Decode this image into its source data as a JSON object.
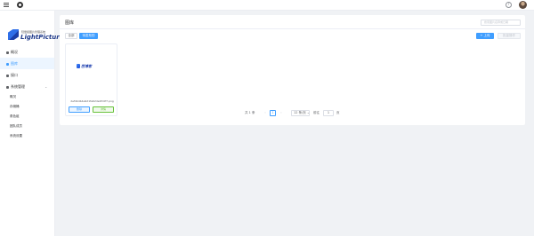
{
  "header": {
    "menu_icon": "hamburger-menu-icon",
    "github_icon": "github-icon",
    "help_icon": "question-circle-icon",
    "help_glyph": "?"
  },
  "sidebar": {
    "logo_tagline": "轻量级图片管理系统",
    "logo_text": "LightPicture",
    "items": [
      {
        "label": "概况",
        "icon": "dashboard-icon"
      },
      {
        "label": "图库",
        "icon": "gallery-icon",
        "active": true
      },
      {
        "label": "接口",
        "icon": "api-icon"
      },
      {
        "label": "系统管理",
        "icon": "settings-icon",
        "caret": "⌄"
      }
    ],
    "subitems": [
      {
        "label": "概况"
      },
      {
        "label": "存储桶"
      },
      {
        "label": "角色组"
      },
      {
        "label": "团队成员"
      },
      {
        "label": "系统设置"
      }
    ]
  },
  "main": {
    "title": "图库",
    "search_placeholder": "搜索图片名称或日期",
    "tabs": [
      {
        "label": "全部"
      },
      {
        "label": "待发布的"
      }
    ],
    "upload_button": "+ 上传",
    "batch_button": "批量操作",
    "images": [
      {
        "thumb_text": "芭博客",
        "filename": "2ef4b4b4e9d1fe62de0fc0f7.png",
        "delete_label": "删除",
        "publish_label": "详情"
      }
    ]
  },
  "pagination": {
    "total": "共 1 条",
    "prev": "‹",
    "current_page": "1",
    "next": "›",
    "page_size": "12 条/页 ⌄",
    "goto_label": "前往",
    "goto_value": "1",
    "page_suffix": "页"
  },
  "colors": {
    "accent": "#409eff",
    "success": "#67c23a",
    "background": "#f0f2f5"
  }
}
